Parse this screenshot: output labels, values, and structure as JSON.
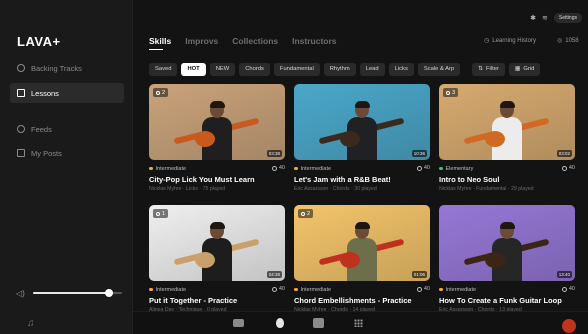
{
  "app": {
    "logo": "LAVA+"
  },
  "status_bar": {
    "bluetooth_icon": "bluetooth-icon",
    "wifi_icon": "wifi-icon",
    "settings_label": "Settings"
  },
  "sidebar": {
    "items": [
      {
        "label": "Backing Tracks",
        "icon": "guitar-pick-icon",
        "active": false
      },
      {
        "label": "Lessons",
        "icon": "lessons-icon",
        "active": true
      },
      {
        "label": "Feeds",
        "icon": "feeds-icon",
        "active": false
      },
      {
        "label": "My Posts",
        "icon": "posts-icon",
        "active": false
      }
    ],
    "volume": {
      "icon": "speaker-icon",
      "level": 0.85
    }
  },
  "tabs": {
    "items": [
      "Skills",
      "Improvs",
      "Collections",
      "Instructors"
    ],
    "active": "Skills",
    "learning_history": "Learning History",
    "coins": "1058"
  },
  "filters": {
    "chips": [
      "Saved",
      "HOT",
      "NEW",
      "Chords",
      "Fundamental",
      "Rhythm",
      "Lead",
      "Licks",
      "Scale & Arp"
    ],
    "active": "HOT",
    "filter_label": "Filter",
    "grid_label": "Grid"
  },
  "lessons": [
    {
      "title": "City-Pop Lick You Must Learn",
      "level": "Intermediate",
      "level_color": "#f2a93b",
      "subtitle": "Nicklas Myhre · Licks · 75 played",
      "score": "40",
      "duration": "03:38",
      "badge": "2",
      "bg": "#c9a27a",
      "shirt": "#1f1f1f",
      "guitar": "#c85a1e"
    },
    {
      "title": "Let's Jam with a R&B Beat!",
      "level": "Intermediate",
      "level_color": "#f2a93b",
      "subtitle": "Eric Assarsson · Chords · 30 played",
      "score": "40",
      "duration": "10:36",
      "badge": "",
      "bg": "#4aa7c9",
      "shirt": "#202124",
      "guitar": "#3a2a1e"
    },
    {
      "title": "Intro to Neo Soul",
      "level": "Elementary",
      "level_color": "#46c06b",
      "subtitle": "Nicklas Myhre · Fundamental · 29 played",
      "score": "40",
      "duration": "03:02",
      "badge": "3",
      "bg": "#d7aa6f",
      "shirt": "#ececec",
      "guitar": "#d06a22"
    },
    {
      "title": "Put it Together - Practice",
      "level": "Intermediate",
      "level_color": "#f2a93b",
      "subtitle": "Alinea Day · Technique · 0 played",
      "score": "40",
      "duration": "04:38",
      "badge": "1",
      "bg": "#efefef",
      "shirt": "#1d1d1d",
      "guitar": "#caa06a"
    },
    {
      "title": "Chord Embellishments - Practice",
      "level": "Intermediate",
      "level_color": "#f2a93b",
      "subtitle": "Nicklas Myhre · Chords · 14 played",
      "score": "40",
      "duration": "01:06",
      "badge": "2",
      "bg": "#f3c46a",
      "shirt": "#6d6e4a",
      "guitar": "#c0301f"
    },
    {
      "title": "How To Create a Funk Guitar Loop",
      "level": "Intermediate",
      "level_color": "#f2a93b",
      "subtitle": "Eric Assarsson · Chords · 13 played",
      "score": "40",
      "duration": "13:40",
      "badge": "",
      "bg": "#9577d6",
      "shirt": "#262626",
      "guitar": "#3b2616"
    }
  ],
  "bottom_bar": {
    "icons": [
      "music-note-icon",
      "keyboard-icon",
      "flame-icon",
      "chord-chart-icon",
      "grid-icon",
      "record-icon"
    ]
  }
}
